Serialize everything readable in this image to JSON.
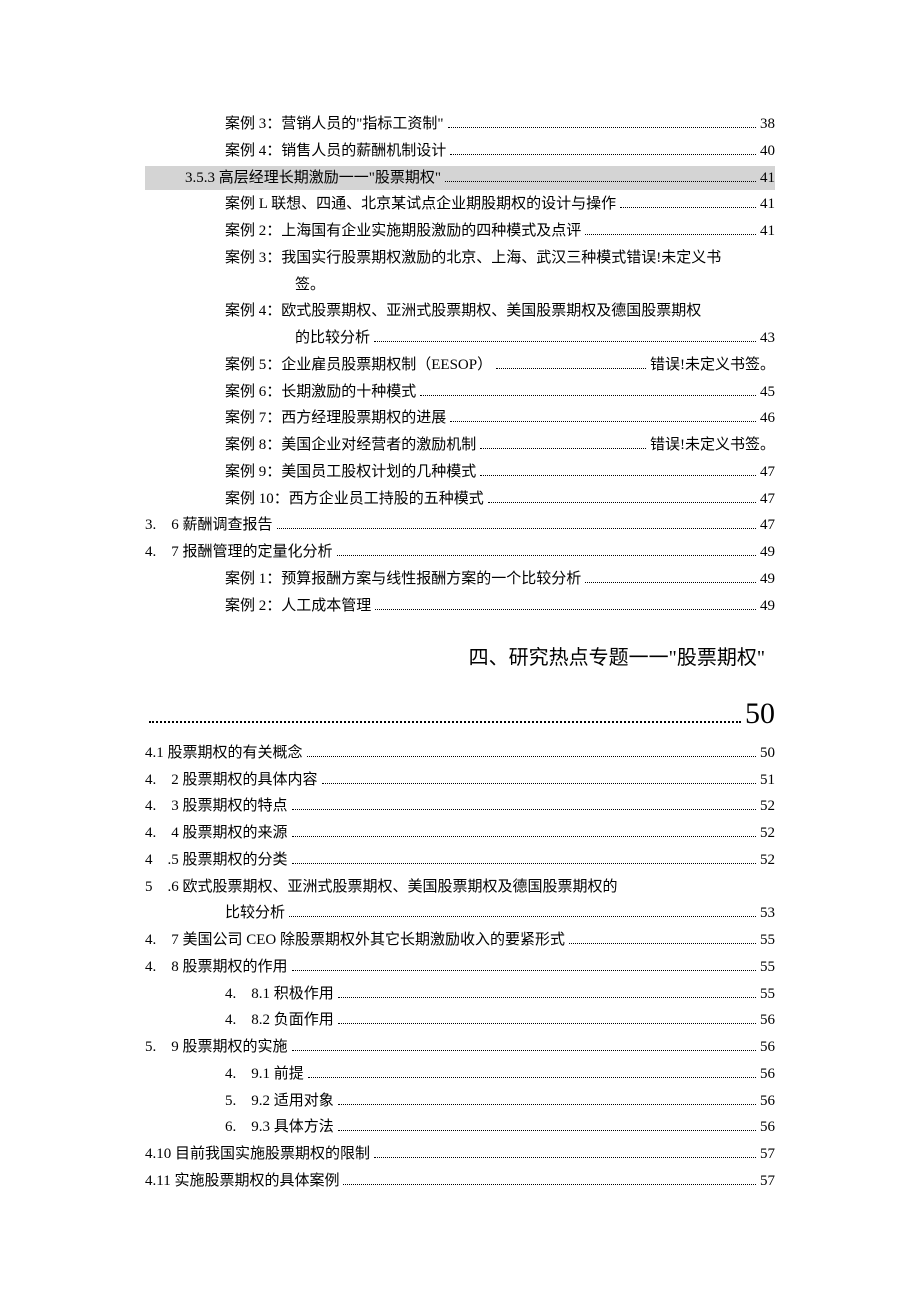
{
  "toc": {
    "e1": {
      "label": "案例 3：营销人员的\"指标工资制\"",
      "page": "38"
    },
    "e2": {
      "label": "案例 4：销售人员的薪酬机制设计",
      "page": "40"
    },
    "e3": {
      "label": "3.5.3 高层经理长期激励一一\"股票期权\"",
      "page": "41"
    },
    "e4": {
      "label": "案例 L 联想、四通、北京某试点企业期股期权的设计与操作",
      "page": "41"
    },
    "e5": {
      "label": "案例 2：上海国有企业实施期股激励的四种模式及点评",
      "page": "41"
    },
    "e6": {
      "label_a": "案例 3：我国实行股票期权激励的北京、上海、武汉三种模式错误!未定义书",
      "label_b": "签。"
    },
    "e7": {
      "label_a": "案例 4：欧式股票期权、亚洲式股票期权、美国股票期权及德国股票期权",
      "label_b": "的比较分析",
      "page": "43"
    },
    "e8": {
      "label": "案例 5：企业雇员股票期权制（EESOP）",
      "page": "错误!未定义书签。"
    },
    "e9": {
      "label": "案例 6：长期激励的十种模式",
      "page": "45"
    },
    "e10": {
      "label": "案例 7：西方经理股票期权的进展",
      "page": "46"
    },
    "e11": {
      "label": "案例 8：美国企业对经营者的激励机制",
      "page": "错误!未定义书签。"
    },
    "e12": {
      "label": "案例 9：美国员工股权计划的几种模式",
      "page": "47"
    },
    "e13": {
      "label": "案例 10：西方企业员工持股的五种模式",
      "page": "47"
    },
    "e14": {
      "label": "3.　6 薪酬调查报告",
      "page": "47"
    },
    "e15": {
      "label": "4.　7 报酬管理的定量化分析",
      "page": "49"
    },
    "e16": {
      "label": "案例 1：预算报酬方案与线性报酬方案的一个比较分析",
      "page": "49"
    },
    "e17": {
      "label": "案例 2：人工成本管理",
      "page": "49"
    },
    "sectionTitle": "四、研究热点专题一一\"股票期权\"",
    "bigPage": "50",
    "e18": {
      "label": "4.1 股票期权的有关概念",
      "page": "50"
    },
    "e19": {
      "label": "4.　2 股票期权的具体内容",
      "page": "51"
    },
    "e20": {
      "label": "4.　3 股票期权的特点",
      "page": "52"
    },
    "e21": {
      "label": "4.　4 股票期权的来源",
      "page": "52"
    },
    "e22": {
      "label": "4　.5 股票期权的分类",
      "page": "52"
    },
    "e23": {
      "label_a": "5　.6 欧式股票期权、亚洲式股票期权、美国股票期权及德国股票期权的",
      "label_b": "比较分析",
      "page": "53"
    },
    "e24": {
      "label": "4.　7 美国公司 CEO 除股票期权外其它长期激励收入的要紧形式",
      "page": "55"
    },
    "e25": {
      "label": "4.　8 股票期权的作用",
      "page": "55"
    },
    "e26": {
      "label": "4.　8.1 积极作用",
      "page": "55"
    },
    "e27": {
      "label": "4.　8.2 负面作用",
      "page": "56"
    },
    "e28": {
      "label": "5.　9 股票期权的实施",
      "page": "56"
    },
    "e29": {
      "label": "4.　9.1 前提",
      "page": "56"
    },
    "e30": {
      "label": "5.　9.2 适用对象",
      "page": "56"
    },
    "e31": {
      "label": "6.　9.3 具体方法",
      "page": "56"
    },
    "e32": {
      "label": "4.10 目前我国实施股票期权的限制",
      "page": "57"
    },
    "e33": {
      "label": "4.11 实施股票期权的具体案例",
      "page": "57"
    }
  }
}
